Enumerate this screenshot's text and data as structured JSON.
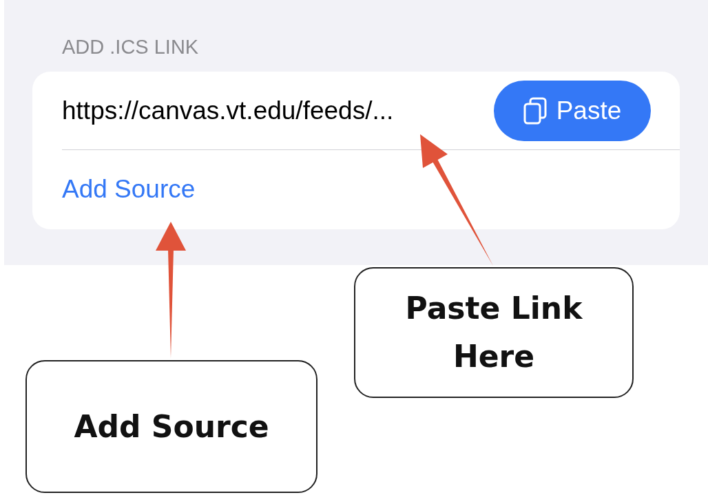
{
  "section": {
    "header": "ADD .ICS LINK",
    "url_field": {
      "value": "https://canvas.vt.edu/feeds/..."
    },
    "paste_button": {
      "label": "Paste"
    },
    "add_source_link": {
      "label": "Add Source"
    }
  },
  "callouts": [
    {
      "text": "Paste Link Here",
      "kind": "paste"
    },
    {
      "text": "Add Source",
      "kind": "add"
    }
  ]
}
